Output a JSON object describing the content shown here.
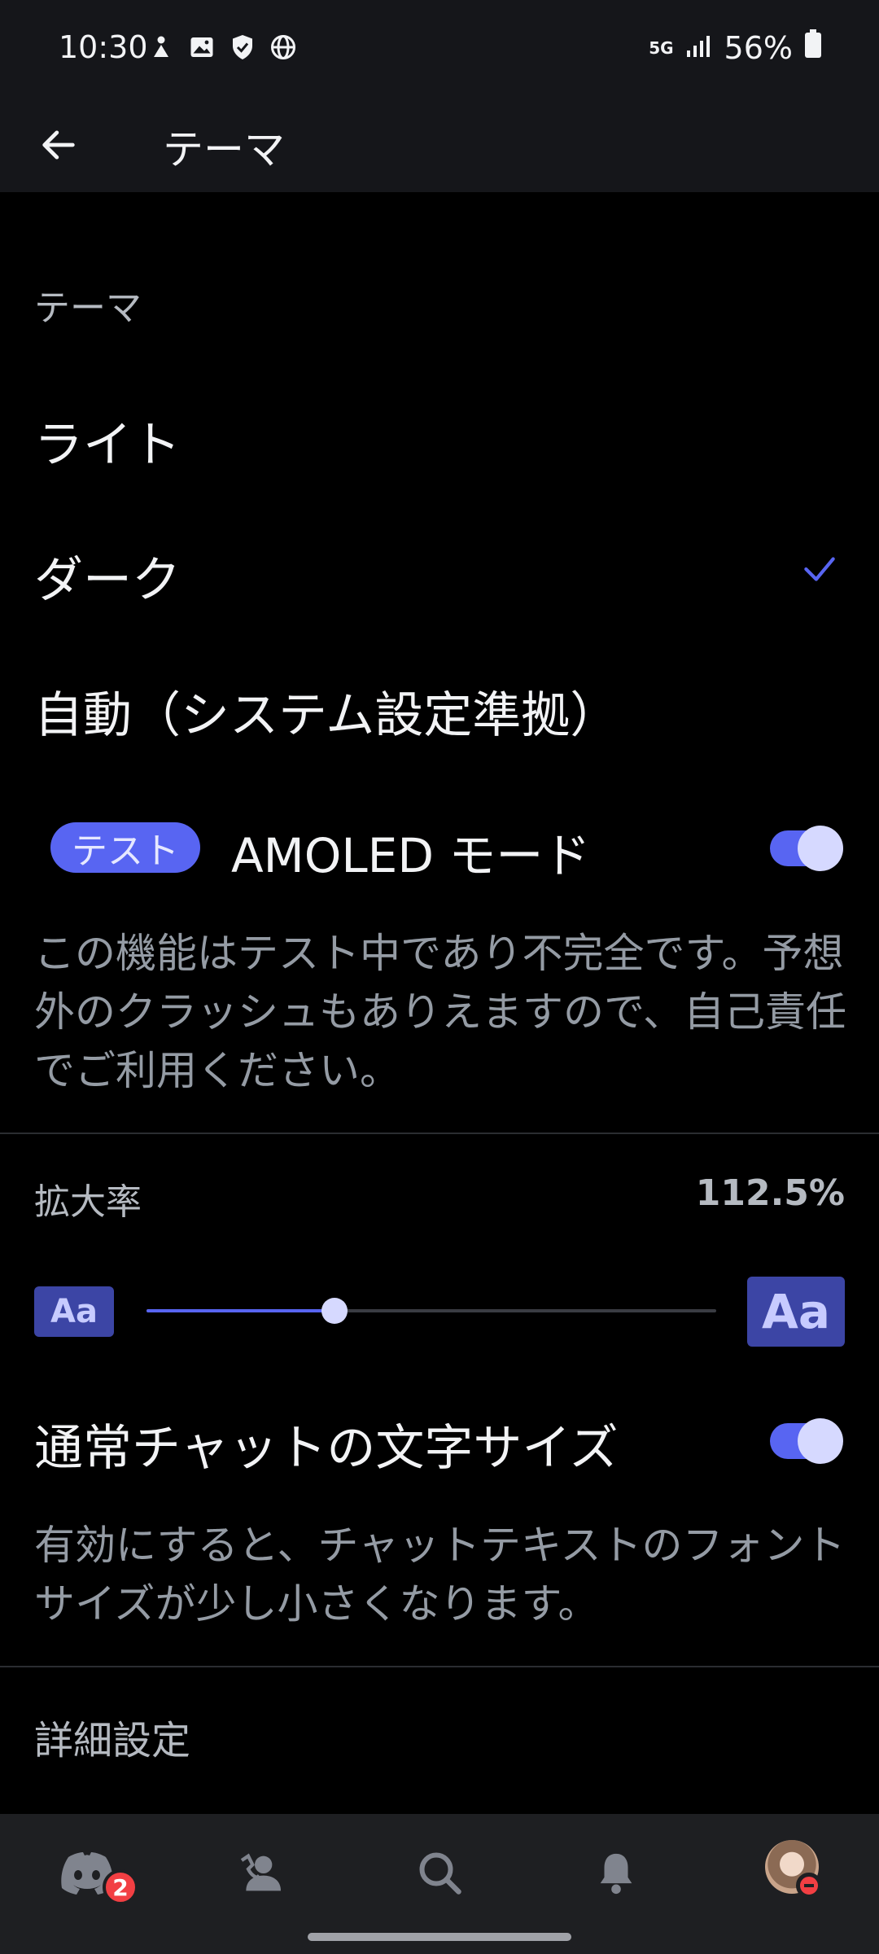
{
  "status_bar": {
    "time": "10:30",
    "network": "5G",
    "battery": "56%"
  },
  "app_bar": {
    "title": "テーマ"
  },
  "theme_section": {
    "label": "テーマ",
    "options": [
      {
        "label": "ライト",
        "selected": false
      },
      {
        "label": "ダーク",
        "selected": true
      },
      {
        "label": "自動（システム設定準拠）",
        "selected": false
      }
    ]
  },
  "amoled": {
    "badge": "テスト",
    "label": "AMOLED モード",
    "enabled": true,
    "description": "この機能はテスト中であり不完全です。予想外のクラッシュもありえますので、自己責任でご利用ください。"
  },
  "zoom": {
    "label": "拡大率",
    "value": "112.5%",
    "small_sample": "Aa",
    "large_sample": "Aa",
    "slider_fraction": 0.33
  },
  "normal_chat": {
    "label": "通常チャットの文字サイズ",
    "enabled": true,
    "description": "有効にすると、チャットテキストのフォントサイズが少し小さくなります。"
  },
  "advanced": {
    "label": "詳細設定"
  },
  "bottom_nav": {
    "items": [
      "discord-home",
      "friends",
      "search",
      "notifications",
      "profile"
    ],
    "badge_count": "2"
  },
  "colors": {
    "accent": "#5865f2",
    "background": "#000000",
    "bar": "#15161a",
    "danger": "#f23f43"
  }
}
